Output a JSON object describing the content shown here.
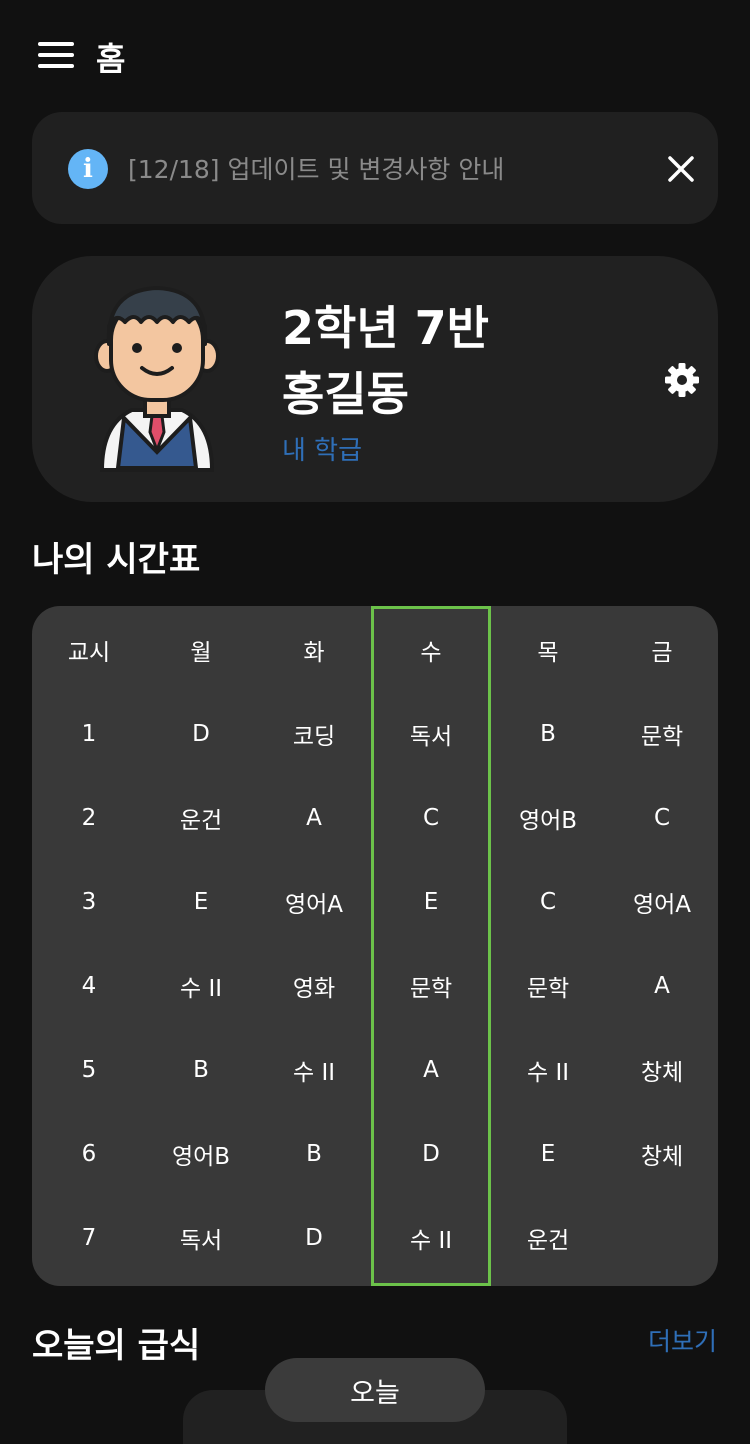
{
  "header": {
    "title": "홈"
  },
  "notice": {
    "text": "[12/18] 업데이트 및 변경사항 안내"
  },
  "profile": {
    "grade_class": "2학년 7반",
    "name": "홍길동",
    "class_link": "내 학급"
  },
  "timetable": {
    "title": "나의 시간표",
    "headers": [
      "교시",
      "월",
      "화",
      "수",
      "목",
      "금"
    ],
    "highlighted_day": "수",
    "rows": [
      [
        "1",
        "D",
        "코딩",
        "독서",
        "B",
        "문학"
      ],
      [
        "2",
        "운건",
        "A",
        "C",
        "영어B",
        "C"
      ],
      [
        "3",
        "E",
        "영어A",
        "E",
        "C",
        "영어A"
      ],
      [
        "4",
        "수 II",
        "영화",
        "문학",
        "문학",
        "A"
      ],
      [
        "5",
        "B",
        "수 II",
        "A",
        "수 II",
        "창체"
      ],
      [
        "6",
        "영어B",
        "B",
        "D",
        "E",
        "창체"
      ],
      [
        "7",
        "독서",
        "D",
        "수 II",
        "운건",
        ""
      ]
    ]
  },
  "meals": {
    "title": "오늘의 급식",
    "more_link": "더보기",
    "day_pill": "오늘"
  },
  "colors": {
    "background": "#111111",
    "card": "#212121",
    "timetable_bg": "#393939",
    "accent_link": "#2f6fb8",
    "today_highlight": "#6cc24a",
    "info_icon": "#64b5f6"
  }
}
